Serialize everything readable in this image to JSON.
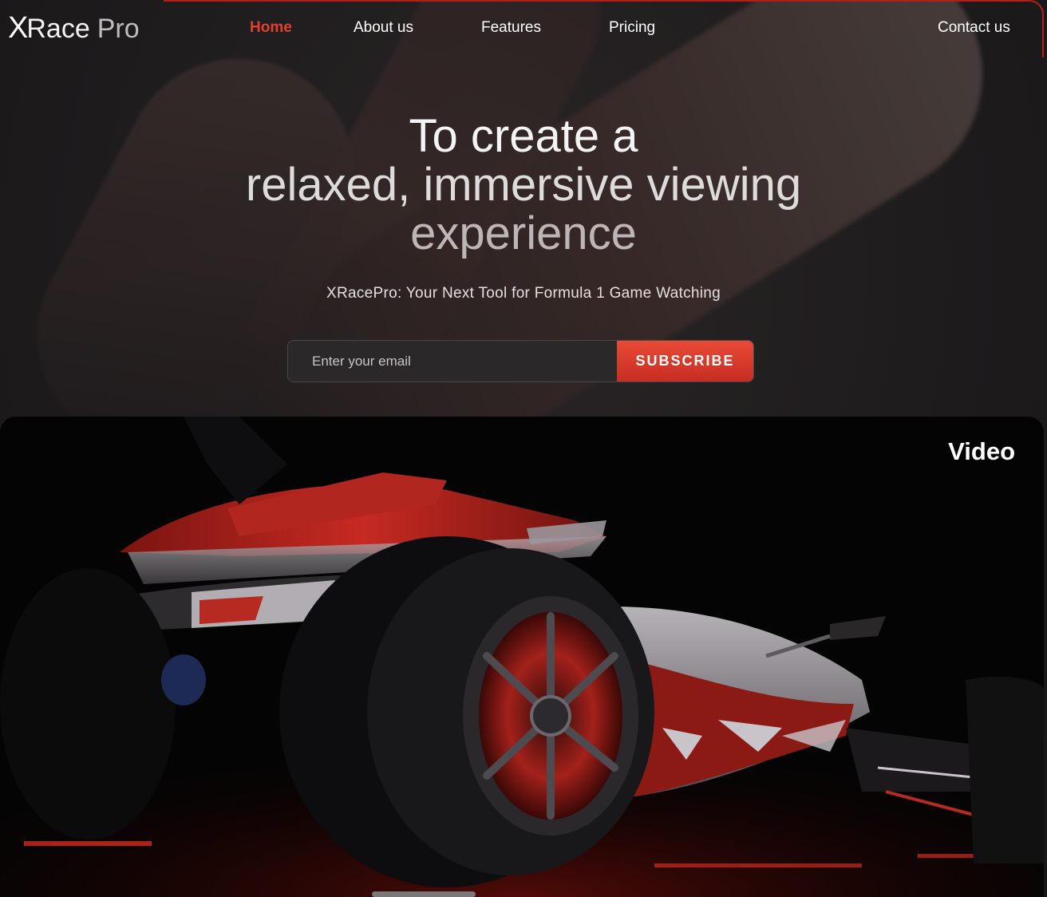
{
  "brand": {
    "logo_x": "X",
    "logo_race": "Race",
    "logo_pro": "Pro"
  },
  "nav": {
    "items": [
      {
        "label": "Home",
        "active": true
      },
      {
        "label": "About us",
        "active": false
      },
      {
        "label": "Features",
        "active": false
      },
      {
        "label": "Pricing",
        "active": false
      },
      {
        "label": "Contact us",
        "active": false
      }
    ]
  },
  "hero": {
    "title_line1": "To create a",
    "title_line2": "relaxed, immersive viewing",
    "title_line3": "experience",
    "subtitle": "XRacePro: Your Next Tool for Formula 1 Game Watching"
  },
  "subscribe": {
    "placeholder": "Enter your email",
    "value": "",
    "button_label": "SUBSCRIBE"
  },
  "video": {
    "label": "Video"
  },
  "colors": {
    "accent": "#e0402f",
    "button": "#d8392a",
    "background": "#1c1a1b"
  }
}
